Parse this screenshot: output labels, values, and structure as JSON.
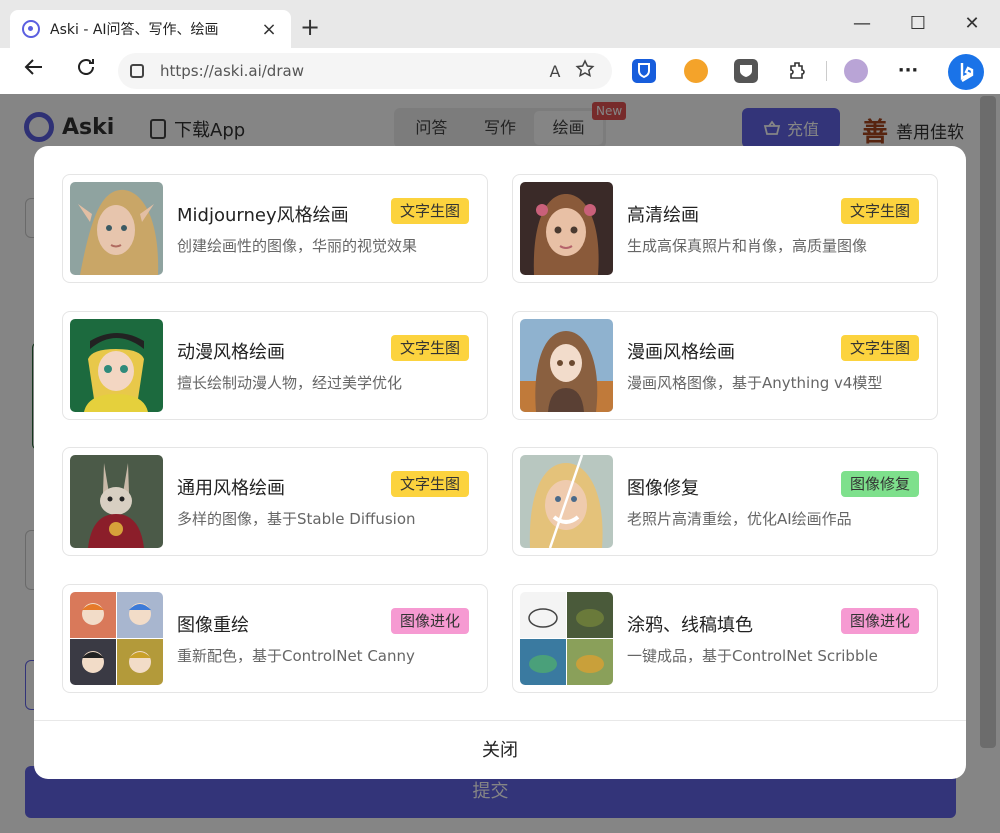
{
  "browser": {
    "tab_title": "Aski - AI问答、写作、绘画",
    "tab_close": "×",
    "new_tab": "+",
    "url": "https://aski.ai/draw",
    "read_aloud": "A",
    "minimize": "—",
    "maximize": "☐",
    "close": "✕",
    "more": "···"
  },
  "site": {
    "logo_text": "Aski",
    "download_label": "下载App",
    "nav": [
      "问答",
      "写作",
      "绘画"
    ],
    "new_badge": "New",
    "recharge_label": "充值",
    "brand_seal": "善",
    "brand_name": "善用佳软",
    "submit_label": "提交"
  },
  "modal": {
    "cards": [
      {
        "title": "Midjourney风格绘画",
        "desc": "创建绘画性的图像，华丽的视觉效果",
        "tag": "文字生图",
        "tag_color": "#fcd33e"
      },
      {
        "title": "高清绘画",
        "desc": "生成高保真照片和肖像，高质量图像",
        "tag": "文字生图",
        "tag_color": "#fcd33e"
      },
      {
        "title": "动漫风格绘画",
        "desc": "擅长绘制动漫人物，经过美学优化",
        "tag": "文字生图",
        "tag_color": "#fcd33e"
      },
      {
        "title": "漫画风格绘画",
        "desc": "漫画风格图像，基于Anything v4模型",
        "tag": "文字生图",
        "tag_color": "#fcd33e"
      },
      {
        "title": "通用风格绘画",
        "desc": "多样的图像，基于Stable Diffusion",
        "tag": "文字生图",
        "tag_color": "#fcd33e"
      },
      {
        "title": "图像修复",
        "desc": "老照片高清重绘，优化AI绘画作品",
        "tag": "图像修复",
        "tag_color": "#7ee08c"
      },
      {
        "title": "图像重绘",
        "desc": "重新配色，基于ControlNet Canny",
        "tag": "图像进化",
        "tag_color": "#f69ad2"
      },
      {
        "title": "涂鸦、线稿填色",
        "desc": "一键成品，基于ControlNet Scribble",
        "tag": "图像进化",
        "tag_color": "#f69ad2"
      }
    ],
    "close_label": "关闭"
  },
  "colors": {
    "accent": "#6264e8",
    "overlay": "rgba(0,0,0,0.48)"
  }
}
